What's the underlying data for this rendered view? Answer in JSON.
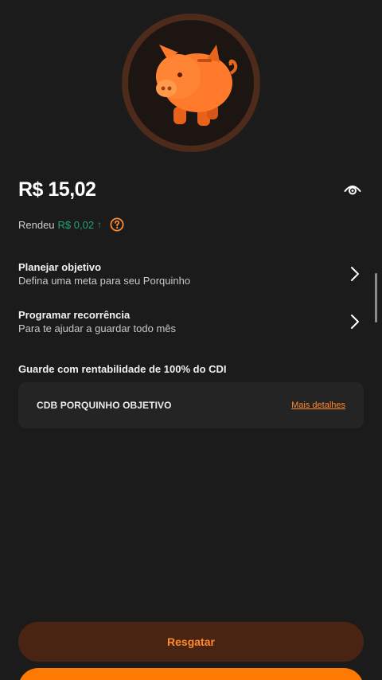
{
  "balance": {
    "amount": "R$ 15,02",
    "visibility_icon": "eye-icon"
  },
  "yield": {
    "label": "Rendeu",
    "value": "R$ 0,02",
    "arrow": "↑",
    "help_icon": "help-circle-icon"
  },
  "menu": [
    {
      "title": "Planejar objetivo",
      "subtitle": "Defina uma meta para seu Porquinho",
      "icon": "chevron-right-icon"
    },
    {
      "title": "Programar recorrência",
      "subtitle": "Para te ajudar a guardar todo mês",
      "icon": "chevron-right-icon"
    }
  ],
  "investment": {
    "section_label": "Guarde com rentabilidade de 100% do CDI",
    "product_name": "CDB PORQUINHO OBJETIVO",
    "details_link": "Mais detalhes"
  },
  "actions": {
    "secondary_label": "Resgatar",
    "primary_label": ""
  },
  "colors": {
    "background": "#1b1b1b",
    "accent": "#ff7a00",
    "accent_dark": "#4a2412",
    "positive": "#1fa37a",
    "card": "#242424"
  },
  "hero_icon": "piggy-bank-icon"
}
